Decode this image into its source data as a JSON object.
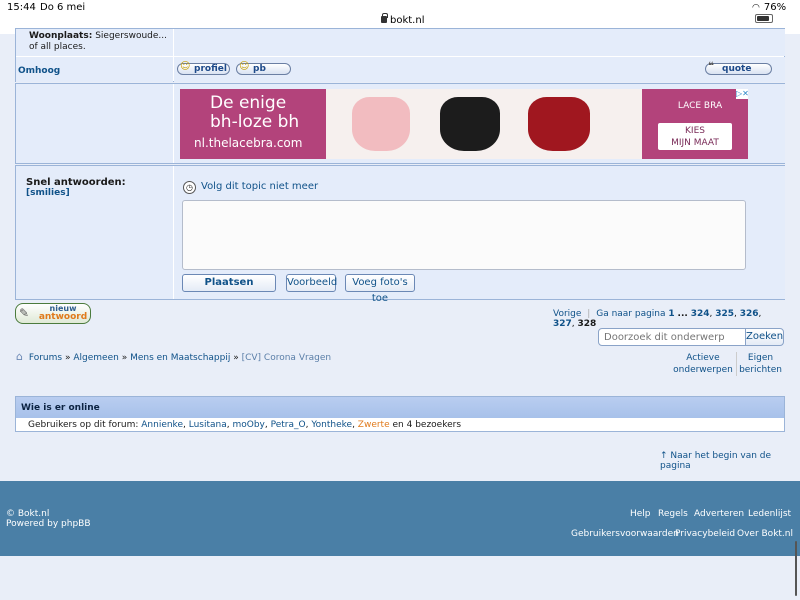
{
  "status": {
    "time": "15:44",
    "date": "Do 6 mei",
    "url": "bokt.nl",
    "battery": "76%"
  },
  "profile": {
    "woonplaats_label": "Woonplaats:",
    "woonplaats_value": "Siegerswoude... of all places."
  },
  "post_actions": {
    "omhoog": "Omhoog",
    "profiel": "profiel",
    "pb": "pb",
    "quote": "quote"
  },
  "ad": {
    "headline_1": "De enige",
    "headline_2": "bh-loze bh",
    "site": "nl.thelacebra.com",
    "brand": "LACE BRA",
    "cta_1": "KIES",
    "cta_2": "MIJN MAAT"
  },
  "quick_reply": {
    "title": "Snel antwoorden:",
    "smilies": "[smilies]",
    "follow": "Volg dit topic niet meer",
    "textarea_value": "",
    "post": "Plaatsen",
    "preview": "Voorbeeld",
    "add_photos": "Voeg foto's toe"
  },
  "new_reply": {
    "line1": "nieuw",
    "line2": "antwoord"
  },
  "pagination": {
    "prev": "Vorige",
    "goto": "Ga naar pagina",
    "p1": "1",
    "dots": "...",
    "p324": "324",
    "p325": "325",
    "p326": "326",
    "p327": "327",
    "p328": "328"
  },
  "search": {
    "placeholder": "Doorzoek dit onderwerp",
    "button": "Zoeken"
  },
  "breadcrumb": {
    "forums": "Forums",
    "algemeen": "Algemeen",
    "mens": "Mens en Maatschappij",
    "topic": "[CV] Corona Vragen"
  },
  "quicklinks": {
    "active_1": "Actieve",
    "active_2": "onderwerpen",
    "own_1": "Eigen",
    "own_2": "berichten"
  },
  "online": {
    "title": "Wie is er online",
    "prefix": "Gebruikers op dit forum:",
    "users": [
      "Annienke",
      "Lusitana",
      "moOby",
      "Petra_O",
      "Yontheke"
    ],
    "user_highlight": "Zwerte",
    "suffix": "en 4 bezoekers"
  },
  "top_link": "↑ Naar het begin van de pagina",
  "footer": {
    "copyright": "© Bokt.nl",
    "powered": "Powered by phpBB",
    "help": "Help",
    "rules": "Regels",
    "advertise": "Adverteren",
    "members": "Ledenlijst",
    "terms": "Gebruikersvoorwaarden",
    "privacy": "Privacybeleid",
    "about": "Over Bokt.nl"
  },
  "colors": {
    "link": "#105289",
    "panel": "#e4ecfa",
    "footer": "#4a7fa6",
    "ad_bg": "#b3437b",
    "highlight_user": "#e07a1c"
  }
}
